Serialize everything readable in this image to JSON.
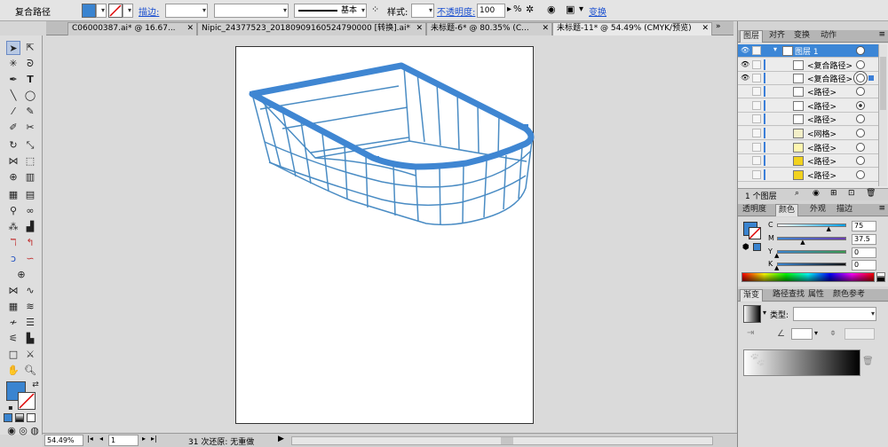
{
  "control_bar": {
    "selection_label": "复合路径",
    "stroke_label": "描边:",
    "stroke_line_label": "基本",
    "style_label": "样式:",
    "opacity_label": "不透明度:",
    "opacity_value": "100",
    "opacity_unit": "%",
    "transform_label": "变换",
    "fill_color": "#3a84d0"
  },
  "tabs": [
    {
      "label": "C06000387.ai* @ 16.67...",
      "active": false
    },
    {
      "label": "Nipic_24377523_20180909160524790000 [转换].ai*",
      "active": false
    },
    {
      "label": "未标题-6* @ 80.35% (C...",
      "active": false
    },
    {
      "label": "未标题-11* @ 54.49% (CMYK/预览)",
      "active": true
    }
  ],
  "status_bar": {
    "zoom": "54.49%",
    "page": "1",
    "undo_text": "31 次还原: 无重做"
  },
  "layers_panel": {
    "tabs": [
      "图层",
      "对齐",
      "变换",
      "动作"
    ],
    "footer_count": "1 个图层",
    "rows": [
      {
        "name": "图层 1",
        "eye": true,
        "selected": true,
        "target": "open"
      },
      {
        "name": "<复合路径>",
        "eye": true,
        "selected": false,
        "target": "open"
      },
      {
        "name": "<复合路径>",
        "eye": true,
        "selected": false,
        "target": "double"
      },
      {
        "name": "<路径>",
        "eye": false,
        "selected": false,
        "target": "open"
      },
      {
        "name": "<路径>",
        "eye": false,
        "selected": false,
        "target": "filled"
      },
      {
        "name": "<路径>",
        "eye": false,
        "selected": false,
        "target": "open"
      },
      {
        "name": "<网格>",
        "eye": false,
        "selected": false,
        "target": "open"
      },
      {
        "name": "<路径>",
        "eye": false,
        "selected": false,
        "target": "open"
      },
      {
        "name": "<路径>",
        "eye": false,
        "selected": false,
        "target": "open"
      },
      {
        "name": "<路径>",
        "eye": false,
        "selected": false,
        "target": "open"
      }
    ]
  },
  "color_panel": {
    "tabs": [
      "透明度",
      "颜色",
      "外观",
      "描边"
    ],
    "channels": [
      {
        "label": "C",
        "value": "75",
        "level": 0.75
      },
      {
        "label": "M",
        "value": "37.5",
        "level": 0.375
      },
      {
        "label": "Y",
        "value": "0",
        "level": 0
      },
      {
        "label": "K",
        "value": "0",
        "level": 0
      }
    ],
    "fill_color": "#3a84d0"
  },
  "gradient_panel": {
    "tabs": [
      "渐变",
      "路径查找",
      "属性",
      "颜色参考"
    ],
    "type_label": "类型:"
  },
  "colors": {
    "accent": "#3a84d0",
    "basket_stroke": "#4a8cc4",
    "rim": "#3f86d2"
  }
}
